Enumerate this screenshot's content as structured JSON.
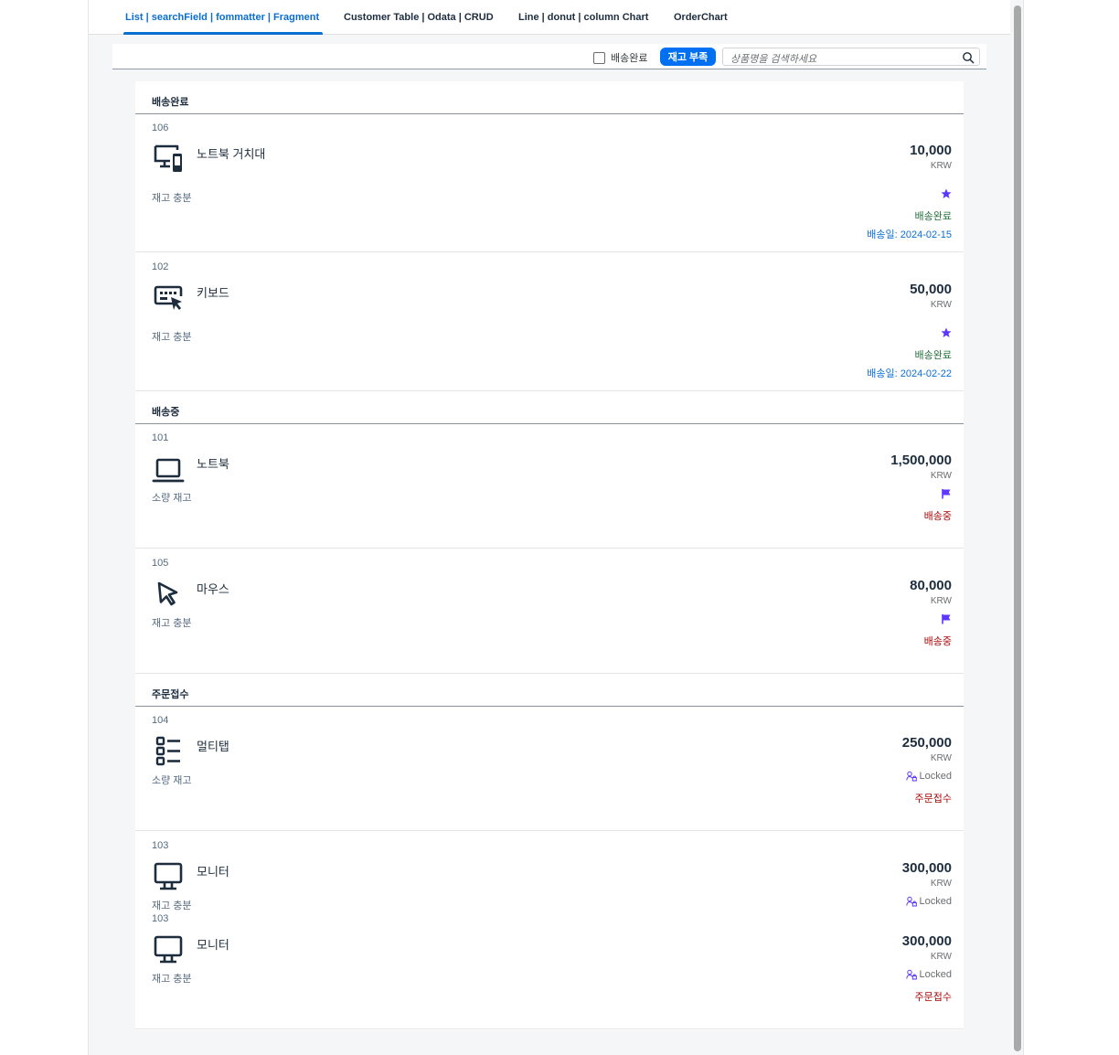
{
  "tabs": [
    {
      "label": "List | searchField | fommatter | Fragment"
    },
    {
      "label": "Customer Table | Odata | CRUD"
    },
    {
      "label": "Line | donut | column Chart"
    },
    {
      "label": "OrderChart"
    }
  ],
  "toolbar": {
    "checkbox_label": "배송완료",
    "checkbox_checked": false,
    "stock_button_label": "재고 부족",
    "search_placeholder": "상품명을 검색하세요"
  },
  "colors": {
    "accent": "#0a6ed1",
    "button": "#0070f2",
    "delivered": "#256f3a",
    "shipping": "#aa0808",
    "received": "#aa0808",
    "icon": "#5d36ff"
  },
  "groups": {
    "delivered": "배송완료",
    "shipping": "배송중",
    "received": "주문접수"
  },
  "items": [
    {
      "id": "106",
      "title": "노트북 거치대",
      "attribute": "재고 충분",
      "price": "10,000",
      "currency": "KRW",
      "icon": "devices-icon",
      "status_icon": "favorite-star-icon",
      "status": "배송완료",
      "date": "배송일: 2024-02-15"
    },
    {
      "id": "102",
      "title": "키보드",
      "attribute": "재고 충분",
      "price": "50,000",
      "currency": "KRW",
      "icon": "keyboard-icon",
      "status_icon": "favorite-star-icon",
      "status": "배송완료",
      "date": "배송일: 2024-02-22"
    },
    {
      "id": "101",
      "title": "노트북",
      "attribute": "소량 재고",
      "price": "1,500,000",
      "currency": "KRW",
      "icon": "laptop-icon",
      "status_icon": "flag-icon",
      "status": "배송중"
    },
    {
      "id": "105",
      "title": "마우스",
      "attribute": "재고 충분",
      "price": "80,000",
      "currency": "KRW",
      "icon": "cursor-icon",
      "status_icon": "flag-icon",
      "status": "배송중"
    },
    {
      "id": "104",
      "title": "멀티탭",
      "attribute": "소량 재고",
      "price": "250,000",
      "currency": "KRW",
      "icon": "list-icon",
      "status_icon": "locked-icon",
      "locked_label": "Locked",
      "status": "주문접수"
    },
    {
      "id": "103",
      "title": "모니터",
      "attribute": "재고 충분",
      "price": "300,000",
      "currency": "KRW",
      "icon": "monitor-icon",
      "status_icon": "locked-icon",
      "locked_label": "Locked"
    },
    {
      "id": "103",
      "title": "모니터",
      "attribute": "재고 충분",
      "price": "300,000",
      "currency": "KRW",
      "icon": "monitor-icon",
      "status_icon": "locked-icon",
      "locked_label": "Locked",
      "status": "주문접수"
    }
  ]
}
